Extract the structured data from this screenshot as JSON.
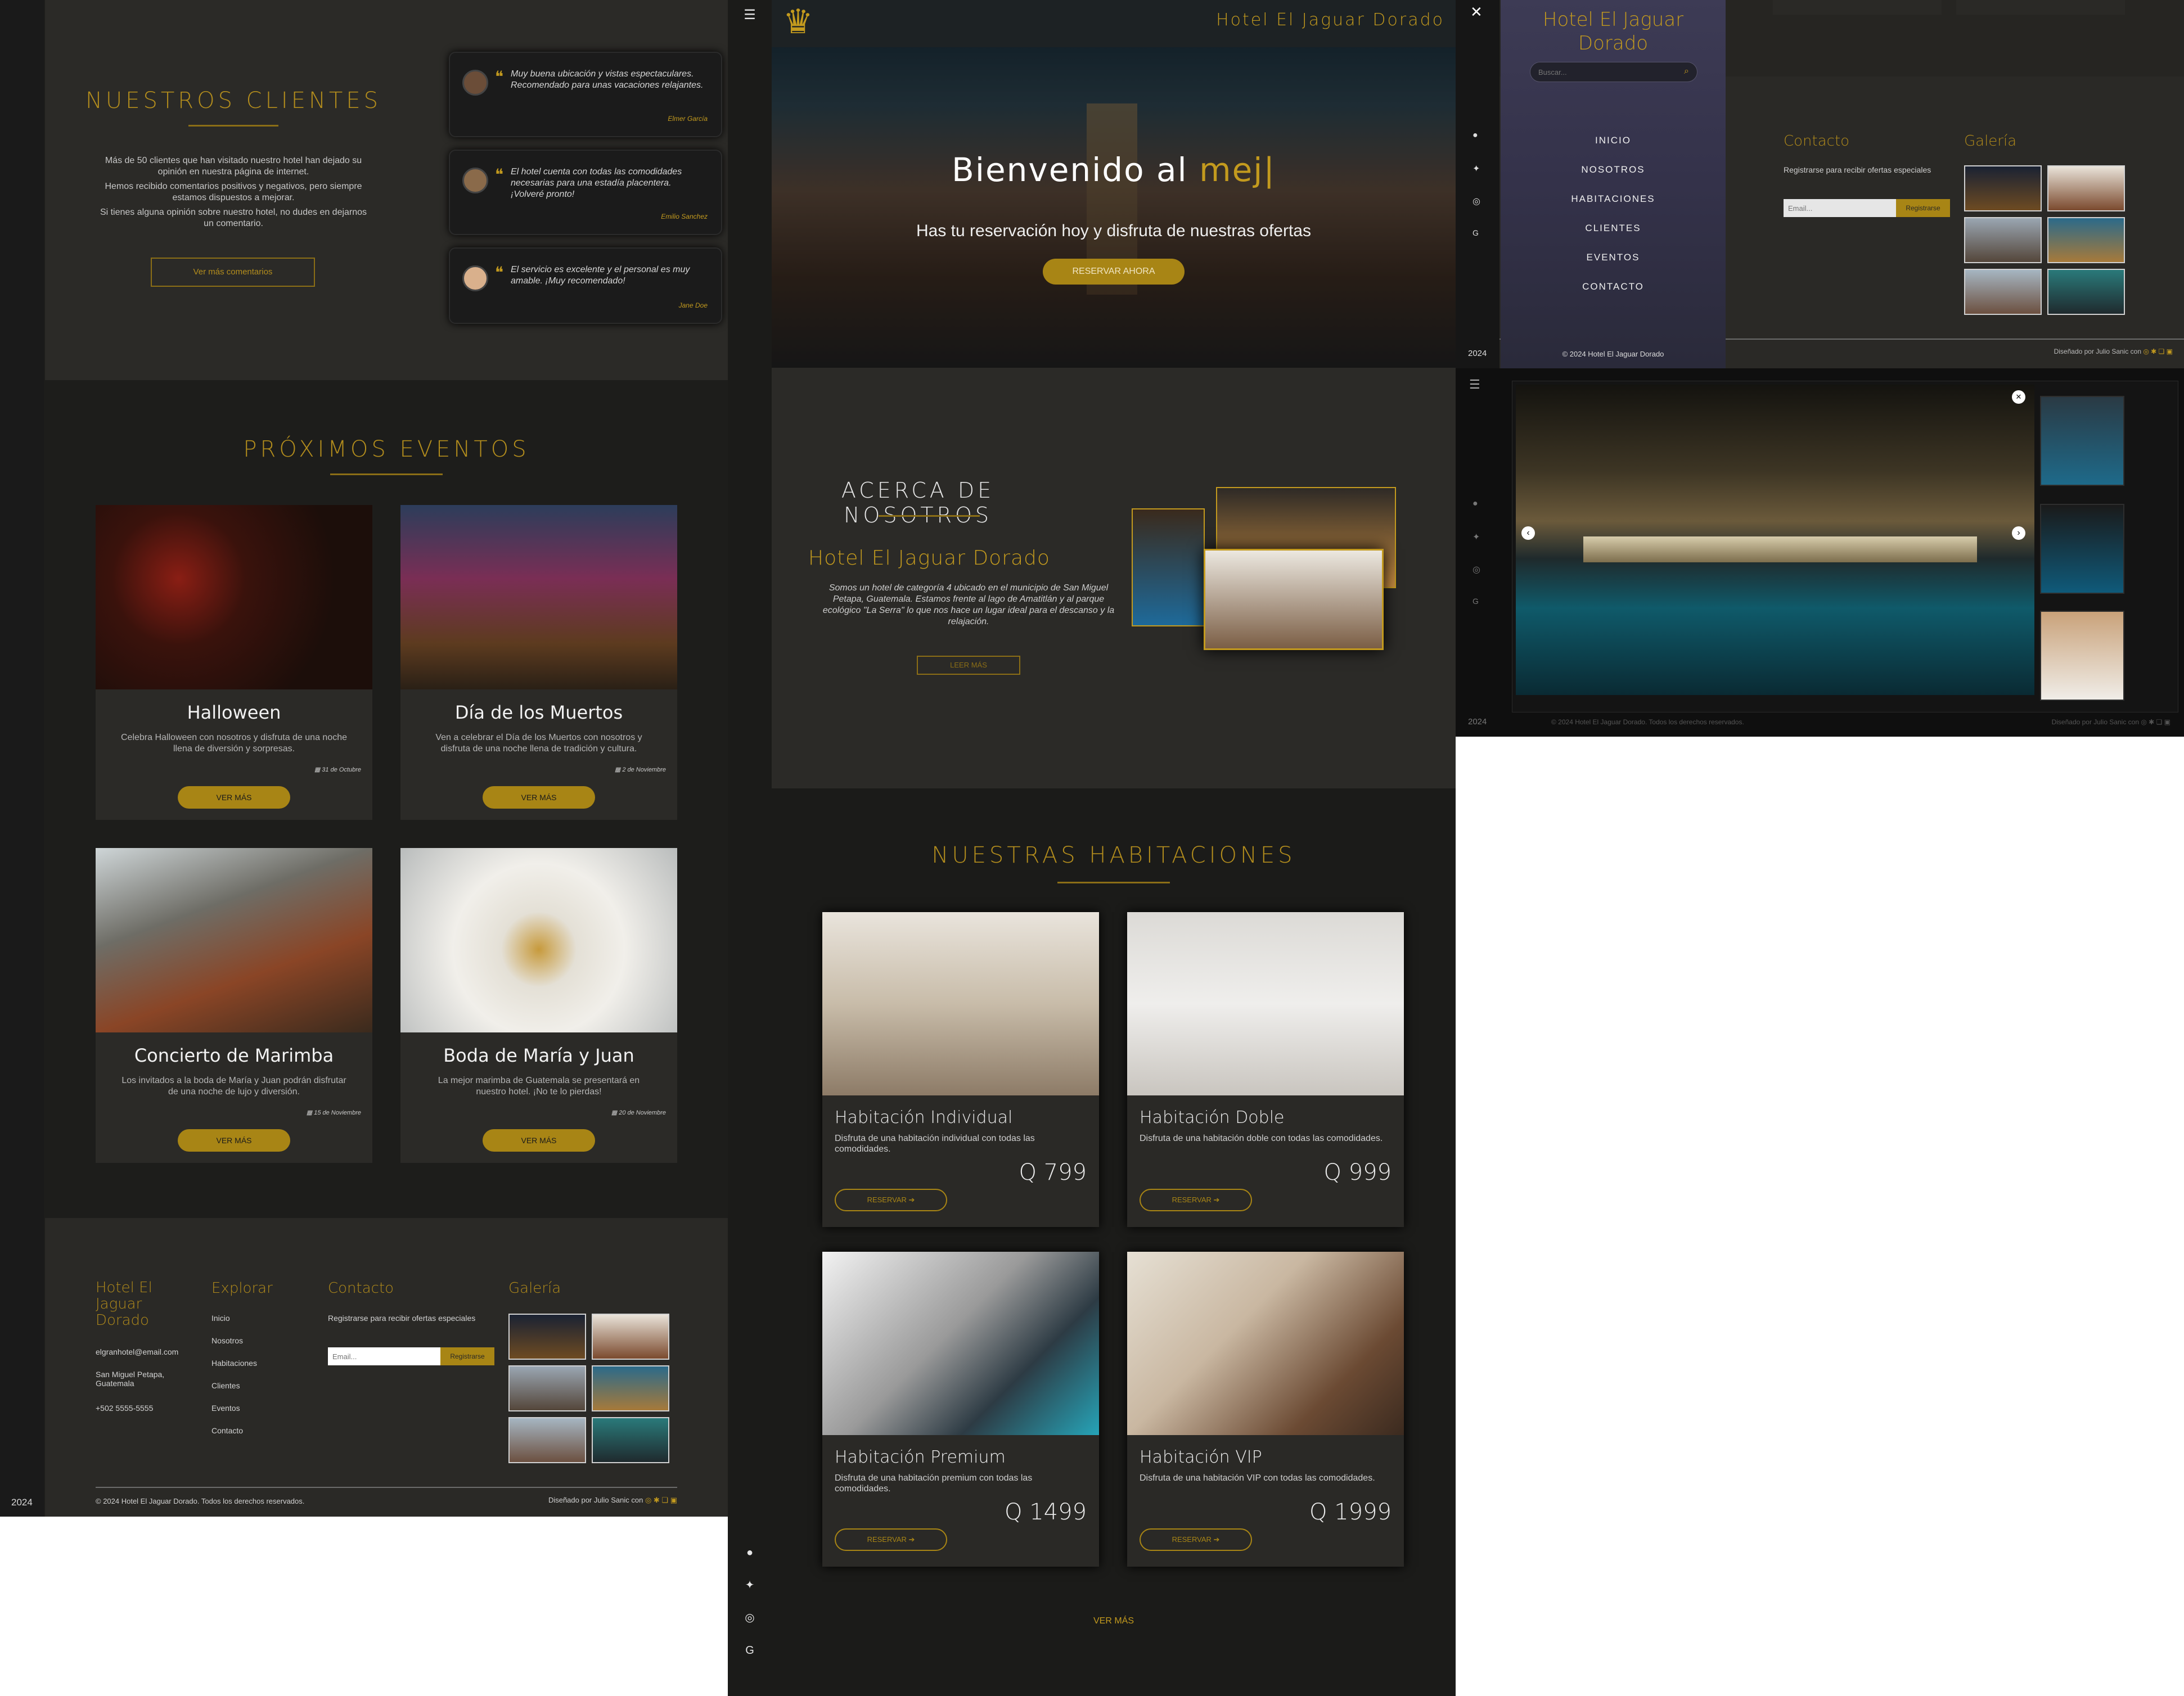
{
  "site": {
    "year": "2024",
    "brand": "Hotel El Jaguar Dorado"
  },
  "clients": {
    "title": "NUESTROS CLIENTES",
    "p1": "Más de 50 clientes que han visitado nuestro hotel han dejado su opinión en nuestra página de internet.",
    "p2": "Hemos recibido comentarios positivos y negativos, pero siempre estamos dispuestos a mejorar.",
    "p3": "Si tienes alguna opinión sobre nuestro hotel, no dudes en dejarnos un comentario.",
    "more_label": "Ver más comentarios",
    "testimonials": [
      {
        "text": "Muy buena ubicación y vistas espectaculares. Recomendado para unas vacaciones relajantes.",
        "author": "Elmer García"
      },
      {
        "text": "El hotel cuenta con todas las comodidades necesarias para una estadía placentera. ¡Volveré pronto!",
        "author": "Emilio Sanchez"
      },
      {
        "text": "El servicio es excelente y el personal es muy amable. ¡Muy recomendado!",
        "author": "Jane Doe"
      }
    ]
  },
  "events": {
    "title": "PRÓXIMOS EVENTOS",
    "items": [
      {
        "title": "Halloween",
        "desc": "Celebra Halloween con nosotros y disfruta de una noche llena de diversión y sorpresas.",
        "date": "31 de Octubre",
        "btn": "VER MÁS"
      },
      {
        "title": "Día de los Muertos",
        "desc": "Ven a celebrar el Día de los Muertos con nosotros y disfruta de una noche llena de tradición y cultura.",
        "date": "2 de Noviembre",
        "btn": "VER MÁS"
      },
      {
        "title": "Concierto de Marimba",
        "desc": "Los invitados a la boda de María y Juan podrán disfrutar de una noche de lujo y diversión.",
        "date": "15 de Noviembre",
        "btn": "VER MÁS"
      },
      {
        "title": "Boda de María y Juan",
        "desc": "La mejor marimba de Guatemala se presentará en nuestro hotel. ¡No te lo pierdas!",
        "date": "20 de Noviembre",
        "btn": "VER MÁS"
      }
    ]
  },
  "footer": {
    "brand": "Hotel El Jaguar Dorado",
    "email": "elgranhotel@email.com",
    "address": "San Miguel Petapa, Guatemala",
    "phone": "+502 5555-5555",
    "explore_title": "Explorar",
    "explore_links": [
      "Inicio",
      "Nosotros",
      "Habitaciones",
      "Clientes",
      "Eventos",
      "Contacto"
    ],
    "contact_title": "Contacto",
    "contact_text": "Registrarse para recibir ofertas especiales",
    "email_placeholder": "Email...",
    "register_btn": "Registrarse",
    "gallery_title": "Galería",
    "copyright": "© 2024 Hotel El Jaguar Dorado. Todos los derechos reservados.",
    "designed": "Diseñado por Julio Sanic con",
    "copyright_short": "© 2024 Hotel El Jaguar Dorado"
  },
  "hero": {
    "brand": "Hotel El Jaguar Dorado",
    "welcome": "Bienvenido al",
    "typed": "mej",
    "subtitle": "Has tu reservación hoy y disfruta de nuestras ofertas",
    "cta": "RESERVAR AHORA"
  },
  "about": {
    "title": "ACERCA DE NOSOTROS",
    "hotel": "Hotel El Jaguar Dorado",
    "text": "Somos un hotel de categoría 4 ubicado en el municipio de San Miguel Petapa, Guatemala. Estamos frente al lago de Amatitlán y al parque ecológico \"La Serra\" lo que nos hace un lugar ideal para el descanso y la relajación.",
    "btn": "LEER MÁS"
  },
  "rooms": {
    "title": "NUESTRAS HABITACIONES",
    "items": [
      {
        "name": "Habitación Individual",
        "desc": "Disfruta de una habitación individual con todas las comodidades.",
        "price": "Q 799",
        "btn": "RESERVAR ➔"
      },
      {
        "name": "Habitación Doble",
        "desc": "Disfruta de una habitación doble con todas las comodidades.",
        "price": "Q 999",
        "btn": "RESERVAR ➔"
      },
      {
        "name": "Habitación Premium",
        "desc": "Disfruta de una habitación premium con todas las comodidades.",
        "price": "Q 1499",
        "btn": "RESERVAR ➔"
      },
      {
        "name": "Habitación VIP",
        "desc": "Disfruta de una habitación VIP con todas las comodidades.",
        "price": "Q 1999",
        "btn": "RESERVAR ➔"
      }
    ],
    "more": "VER MÁS"
  },
  "menu": {
    "search_placeholder": "Buscar...",
    "items": [
      "INICIO",
      "NOSOTROS",
      "HABITACIONES",
      "CLIENTES",
      "EVENTOS",
      "CONTACTO"
    ]
  },
  "colors": {
    "accent": "#c39a1e",
    "bg_dark": "#1b1b19",
    "card": "#2a2926"
  }
}
